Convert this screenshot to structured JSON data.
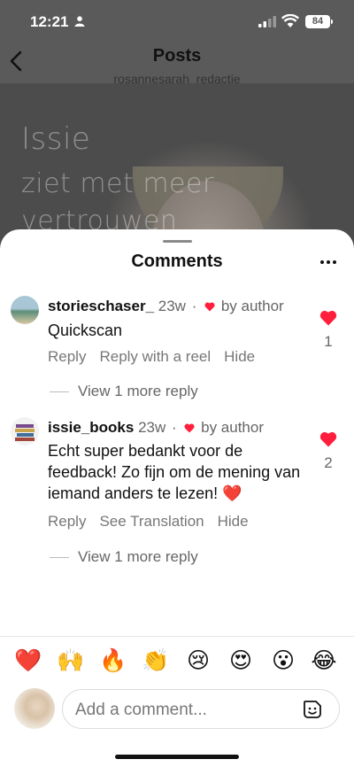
{
  "status": {
    "time": "12:21",
    "battery": "84"
  },
  "nav": {
    "title": "Posts",
    "subtitle": "rosannesarah_redactie"
  },
  "post_overlay": {
    "line1": "Issie",
    "line2": "ziet met meer",
    "line3": "vertrouwen"
  },
  "sheet": {
    "title": "Comments"
  },
  "comments": [
    {
      "username": "storieschaser_",
      "age": "23w",
      "by_author": "by author",
      "text": "Quickscan",
      "actions": [
        "Reply",
        "Reply with a reel",
        "Hide"
      ],
      "likes": "1",
      "view_more": "View 1 more reply"
    },
    {
      "username": "issie_books",
      "age": "23w",
      "by_author": "by author",
      "text": "Echt super bedankt voor de feedback! Zo fijn om de mening van iemand anders te lezen! ❤️",
      "actions": [
        "Reply",
        "See Translation",
        "Hide"
      ],
      "likes": "2",
      "view_more": "View 1 more reply"
    }
  ],
  "emojis": [
    "❤️",
    "🙌",
    "🔥",
    "👏",
    "😢",
    "😍",
    "😮",
    "😂"
  ],
  "composer": {
    "placeholder": "Add a comment..."
  },
  "colors": {
    "heart": "#ff1f3d",
    "muted": "#777777"
  }
}
